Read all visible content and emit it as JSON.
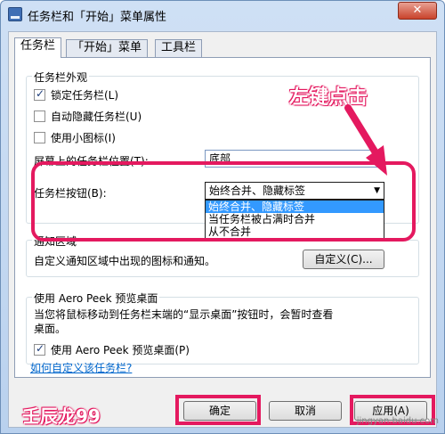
{
  "window": {
    "title": "任务栏和「开始」菜单属性",
    "close_glyph": "✕"
  },
  "tabs": [
    {
      "label": "任务栏"
    },
    {
      "label": "「开始」菜单"
    },
    {
      "label": "工具栏"
    }
  ],
  "appearance": {
    "group_title": "任务栏外观",
    "lock": {
      "label": "锁定任务栏(L)",
      "checked": true
    },
    "autohide": {
      "label": "自动隐藏任务栏(U)",
      "checked": false
    },
    "small_icons": {
      "label": "使用小图标(I)",
      "checked": false
    },
    "position_label": "屏幕上的任务栏位置(T):",
    "position_value": "底部",
    "buttons_label": "任务栏按钮(B):",
    "buttons_value": "始终合并、隐藏标签",
    "buttons_options": [
      "始终合并、隐藏标签",
      "当任务栏被占满时合并",
      "从不合并"
    ]
  },
  "notification": {
    "group_title": "通知区域",
    "description": "自定义通知区域中出现的图标和通知。",
    "customize_button": "自定义(C)..."
  },
  "aero": {
    "group_title": "使用 Aero Peek 预览桌面",
    "description_line1": "当您将鼠标移动到任务栏末端的“显示桌面”按钮时，会暂时查看",
    "description_line2": "桌面。",
    "checkbox": {
      "label": "使用 Aero Peek 预览桌面(P)",
      "checked": true
    }
  },
  "help_link": "如何自定义该任务栏?",
  "buttons": {
    "ok": "确定",
    "cancel": "取消",
    "apply": "应用(A)"
  },
  "annotations": {
    "click_note": "左键点击",
    "author": "壬辰龙99",
    "watermark": "jingyan.baidu.com"
  },
  "colors": {
    "highlight": "#e4195f",
    "selection": "#3399ff",
    "link": "#0066cc"
  }
}
